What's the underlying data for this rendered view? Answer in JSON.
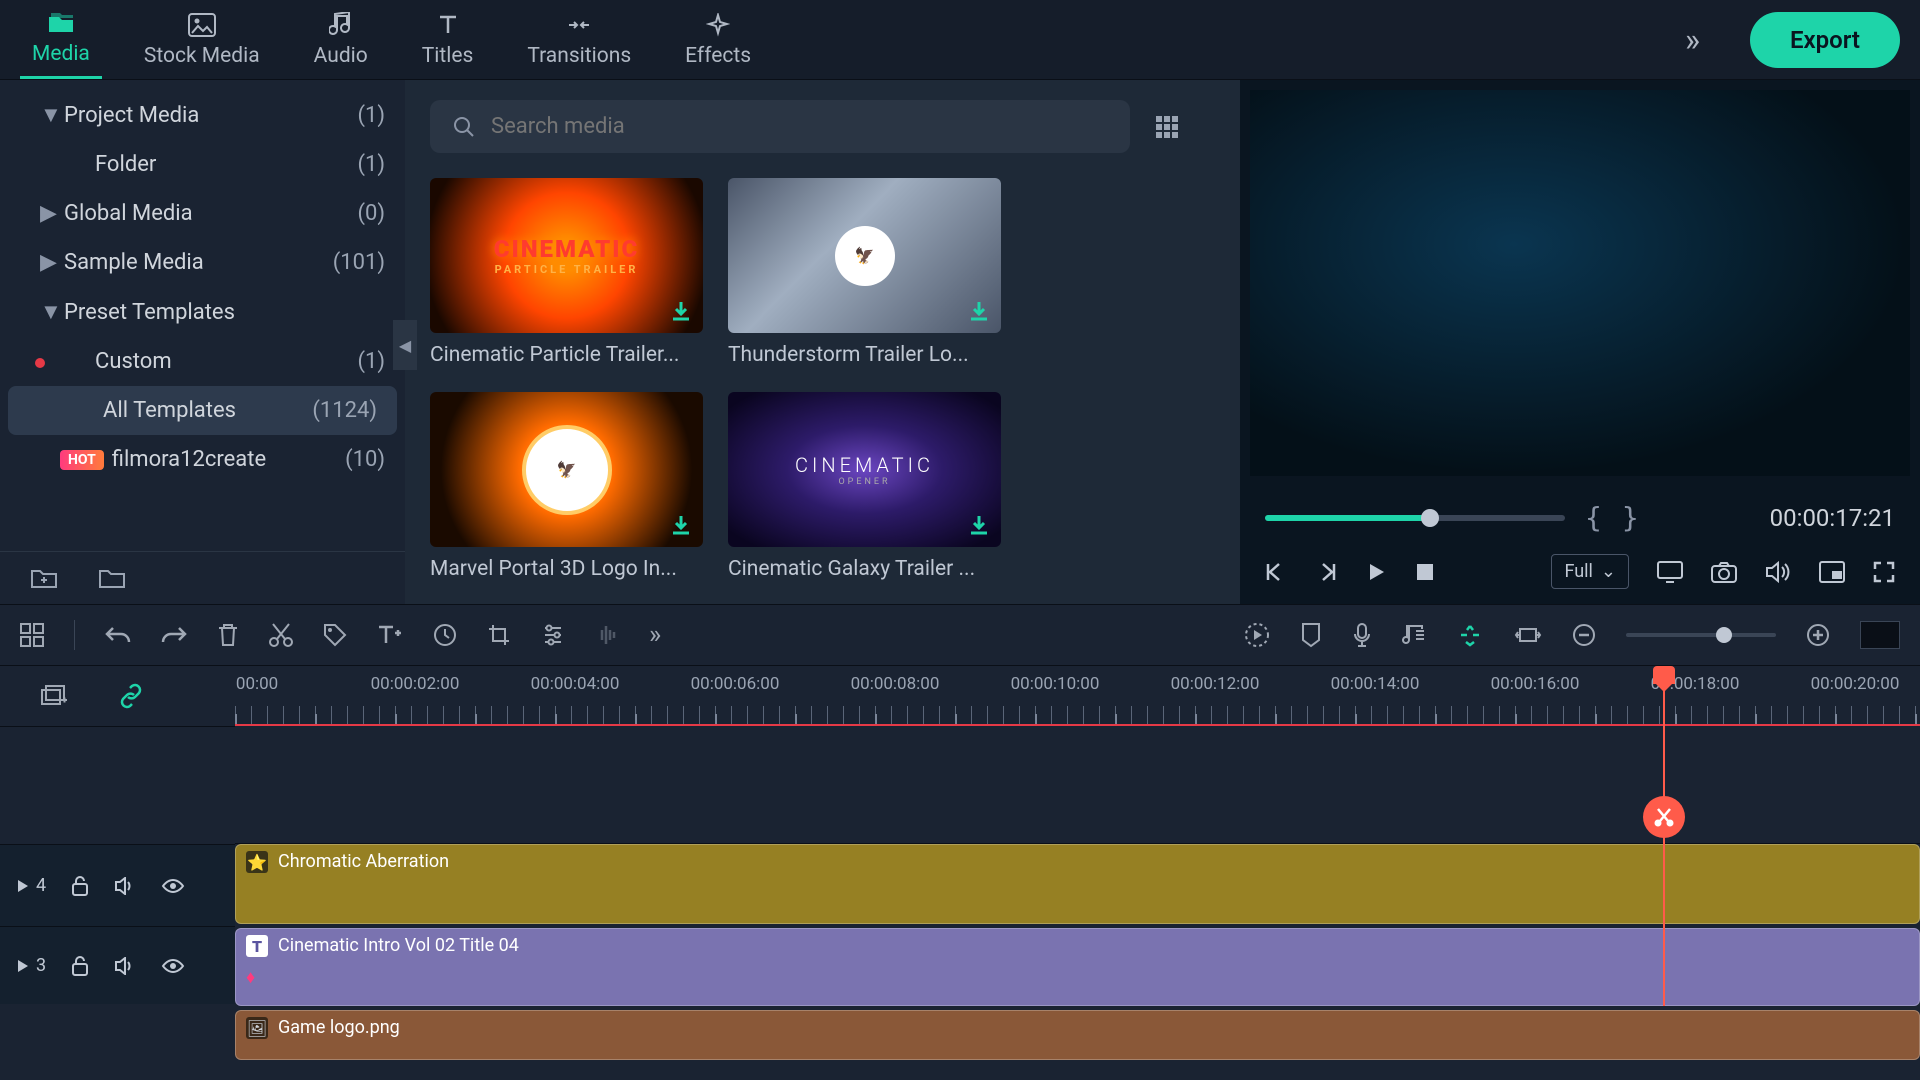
{
  "tabs": {
    "media": "Media",
    "stock_media": "Stock Media",
    "audio": "Audio",
    "titles": "Titles",
    "transitions": "Transitions",
    "effects": "Effects"
  },
  "export_label": "Export",
  "sidebar": {
    "items": [
      {
        "label": "Project Media",
        "count": "(1)"
      },
      {
        "label": "Folder",
        "count": "(1)"
      },
      {
        "label": "Global Media",
        "count": "(0)"
      },
      {
        "label": "Sample Media",
        "count": "(101)"
      },
      {
        "label": "Preset Templates",
        "count": ""
      },
      {
        "label": "Custom",
        "count": "(1)"
      },
      {
        "label": "All Templates",
        "count": "(1124)"
      },
      {
        "label": "filmora12create",
        "count": "(10)"
      }
    ],
    "hot_badge": "HOT"
  },
  "search": {
    "placeholder": "Search media"
  },
  "media": [
    {
      "label": "Cinematic Particle Trailer..."
    },
    {
      "label": "Thunderstorm Trailer Lo..."
    },
    {
      "label": "Marvel Portal 3D Logo In..."
    },
    {
      "label": "Cinematic Galaxy Trailer ..."
    }
  ],
  "thumb_text": {
    "t1a": "CINEMATIC",
    "t1b": "PARTICLE TRAILER",
    "t4a": "CINEMATIC",
    "t4b": "OPENER"
  },
  "preview": {
    "timecode": "00:00:17:21",
    "full_label": "Full"
  },
  "ruler": [
    ":00:00",
    "00:00:02:00",
    "00:00:04:00",
    "00:00:06:00",
    "00:00:08:00",
    "00:00:10:00",
    "00:00:12:00",
    "00:00:14:00",
    "00:00:16:00",
    "00:00:18:00",
    "00:00:20:00"
  ],
  "tracks": {
    "t4": "4",
    "t3": "3"
  },
  "clips": {
    "c1": "Chromatic Aberration",
    "c2": "Cinematic Intro Vol 02 Title 04",
    "c3": "Game logo.png"
  }
}
